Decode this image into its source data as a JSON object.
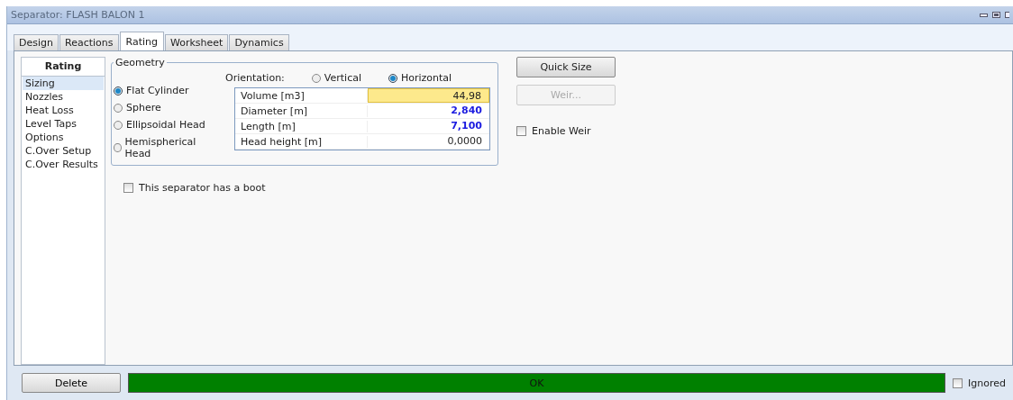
{
  "window": {
    "title": "Separator: FLASH BALON 1"
  },
  "tabs": [
    {
      "label": "Design",
      "selected": false
    },
    {
      "label": "Reactions",
      "selected": false
    },
    {
      "label": "Rating",
      "selected": true
    },
    {
      "label": "Worksheet",
      "selected": false
    },
    {
      "label": "Dynamics",
      "selected": false
    }
  ],
  "sidebar": {
    "title": "Rating",
    "items": [
      {
        "label": "Sizing",
        "selected": true
      },
      {
        "label": "Nozzles",
        "selected": false
      },
      {
        "label": "Heat Loss",
        "selected": false
      },
      {
        "label": "Level Taps",
        "selected": false
      },
      {
        "label": "Options",
        "selected": false
      },
      {
        "label": "C.Over Setup",
        "selected": false
      },
      {
        "label": "C.Over Results",
        "selected": false
      }
    ]
  },
  "geometry": {
    "title": "Geometry",
    "shapes": [
      {
        "label": "Flat Cylinder",
        "selected": true
      },
      {
        "label": "Sphere",
        "selected": false
      },
      {
        "label": "Ellipsoidal Head",
        "selected": false
      },
      {
        "label": "Hemispherical Head",
        "selected": false
      }
    ],
    "orientation_label": "Orientation:",
    "orientations": [
      {
        "label": "Vertical",
        "selected": false
      },
      {
        "label": "Horizontal",
        "selected": true
      }
    ],
    "rows": [
      {
        "label": "Volume [m3]",
        "value": "44,98",
        "kind": "calculated",
        "selected": true
      },
      {
        "label": "Diameter [m]",
        "value": "2,840",
        "kind": "specified",
        "selected": false
      },
      {
        "label": "Length [m]",
        "value": "7,100",
        "kind": "specified",
        "selected": false
      },
      {
        "label": "Head height [m]",
        "value": "0,0000",
        "kind": "calculated",
        "selected": false
      }
    ]
  },
  "boot_checkbox": {
    "label": "This separator has a boot",
    "checked": false
  },
  "buttons": [
    {
      "label": "Quick Size",
      "disabled": false
    },
    {
      "label": "Weir...",
      "disabled": true
    }
  ],
  "enable_weir": {
    "label": "Enable Weir",
    "checked": false
  },
  "status_bar": {
    "delete": "Delete",
    "status": "OK",
    "ignored": {
      "label": "Ignored",
      "checked": false
    }
  }
}
